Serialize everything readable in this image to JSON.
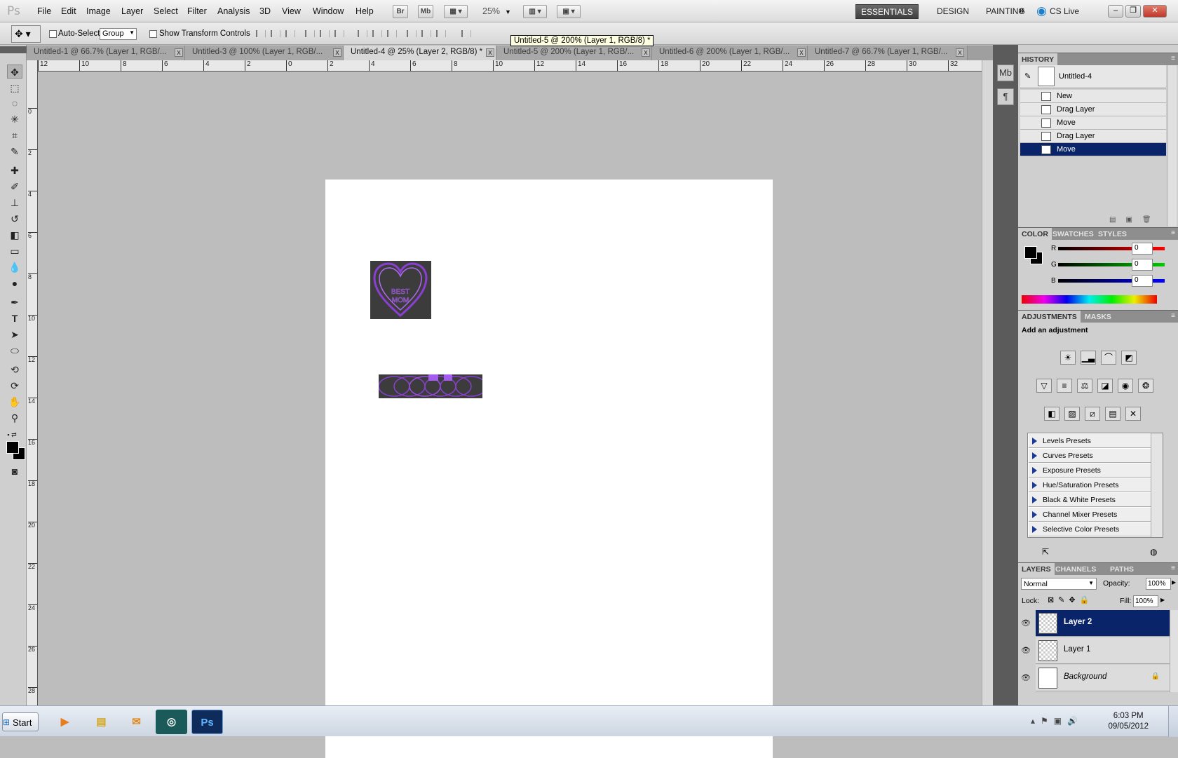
{
  "app": {
    "logo": "Ps"
  },
  "menu": [
    "File",
    "Edit",
    "Image",
    "Layer",
    "Select",
    "Filter",
    "Analysis",
    "3D",
    "View",
    "Window",
    "Help"
  ],
  "appbar": {
    "br": "Br",
    "mb": "Mb",
    "zoom": "25%"
  },
  "workspaces": [
    "ESSENTIALS",
    "DESIGN",
    "PAINTING"
  ],
  "cslive": "CS Live",
  "options": {
    "auto_select_label": "Auto-Select:",
    "auto_select_value": "Group",
    "show_transform_label": "Show Transform Controls"
  },
  "tooltip": "Untitled-5 @ 200% (Layer 1, RGB/8) *",
  "tabs": [
    {
      "label": "Untitled-1 @ 66.7% (Layer 1, RGB/...",
      "active": false
    },
    {
      "label": "Untitled-3 @ 100% (Layer 1, RGB/...",
      "active": false
    },
    {
      "label": "Untitled-4 @ 25% (Layer 2, RGB/8) *",
      "active": true
    },
    {
      "label": "Untitled-5 @ 200% (Layer 1, RGB/...",
      "active": false
    },
    {
      "label": "Untitled-6 @ 200% (Layer 1, RGB/...",
      "active": false
    },
    {
      "label": "Untitled-7 @ 66.7% (Layer 1, RGB/...",
      "active": false
    }
  ],
  "ruler_top": [
    "12",
    "10",
    "8",
    "6",
    "4",
    "2",
    "0",
    "2",
    "4",
    "6",
    "8",
    "10",
    "12",
    "14",
    "16",
    "18",
    "20",
    "22",
    "24",
    "26",
    "28",
    "30",
    "32"
  ],
  "ruler_left": [
    "0",
    "2",
    "4",
    "6",
    "8",
    "10",
    "12",
    "14",
    "16",
    "18",
    "20",
    "22",
    "24",
    "26",
    "28"
  ],
  "canvas": {
    "heart_text_1": "BEST",
    "heart_text_2": "MOM"
  },
  "history": {
    "title": "HISTORY",
    "snapshot": "Untitled-4",
    "items": [
      {
        "label": "New",
        "selected": false
      },
      {
        "label": "Drag Layer",
        "selected": false
      },
      {
        "label": "Move",
        "selected": false
      },
      {
        "label": "Drag Layer",
        "selected": false
      },
      {
        "label": "Move",
        "selected": true
      }
    ]
  },
  "color_panel": {
    "tabs": [
      "COLOR",
      "SWATCHES",
      "STYLES"
    ],
    "channels": [
      {
        "name": "R",
        "value": "0"
      },
      {
        "name": "G",
        "value": "0"
      },
      {
        "name": "B",
        "value": "0"
      }
    ]
  },
  "adjustments": {
    "tabs": [
      "ADJUSTMENTS",
      "MASKS"
    ],
    "heading": "Add an adjustment",
    "presets": [
      "Levels Presets",
      "Curves Presets",
      "Exposure Presets",
      "Hue/Saturation Presets",
      "Black & White Presets",
      "Channel Mixer Presets",
      "Selective Color Presets"
    ]
  },
  "layers_panel": {
    "tabs": [
      "LAYERS",
      "CHANNELS",
      "PATHS"
    ],
    "blend_mode": "Normal",
    "opacity_label": "Opacity:",
    "opacity": "100%",
    "lock_label": "Lock:",
    "fill_label": "Fill:",
    "fill": "100%",
    "layers": [
      {
        "name": "Layer 2",
        "selected": true
      },
      {
        "name": "Layer 1",
        "selected": false
      },
      {
        "name": "Background",
        "selected": false
      }
    ]
  },
  "taskbar": {
    "start": "Start",
    "time": "6:03 PM",
    "date": "09/05/2012"
  }
}
